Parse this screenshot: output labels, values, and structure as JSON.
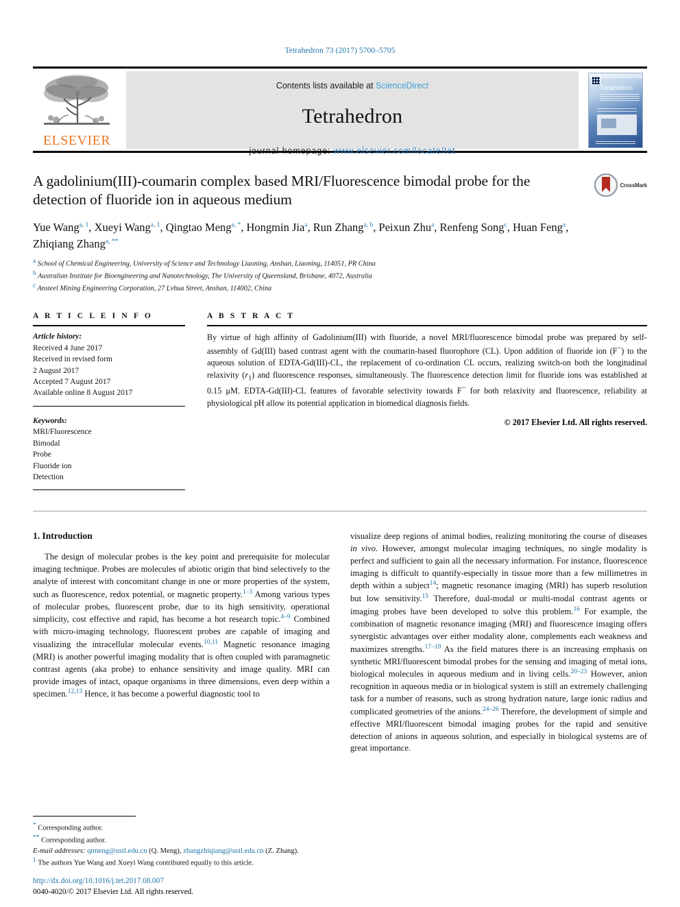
{
  "running_head": "Tetrahedron 73 (2017) 5700–5705",
  "masthead": {
    "publisher_name": "ELSEVIER",
    "contents_prefix": "Contents lists available at ",
    "contents_link": "ScienceDirect",
    "journal_name": "Tetrahedron",
    "homepage_prefix": "journal homepage: ",
    "homepage_url": "www.elsevier.com/locate/tet",
    "cover_title": "Tetrahedron"
  },
  "article": {
    "title": "A gadolinium(III)-coumarin complex based MRI/Fluorescence bimodal probe for the detection of fluoride ion in aqueous medium",
    "crossmark_label": "CrossMark",
    "authors_line1": "Yue Wang",
    "authors_html_line1_sup": "a, 1",
    "affiliations": [
      "School of Chemical Engineering, University of Science and Technology Liaoning, Anshan, Liaoning, 114051, PR China",
      "Australian Institute for Bioengineering and Nanotechnology, The University of Queensland, Brisbane, 4072, Australia",
      "Ansteel Mining Engineering Corporation, 27 Lvhua Street, Anshan, 114002, China"
    ],
    "affiliation_markers": [
      "a",
      "b",
      "c"
    ],
    "authors": [
      {
        "name": "Yue Wang",
        "sup": "a, 1",
        "sep": ", "
      },
      {
        "name": "Xueyi Wang",
        "sup": "a, 1",
        "sep": ", "
      },
      {
        "name": "Qingtao Meng",
        "sup": "a, *",
        "sep": ", "
      },
      {
        "name": "Hongmin Jia",
        "sup": "a",
        "sep": ", "
      },
      {
        "name": "Run Zhang",
        "sup": "a, b",
        "sep": ", "
      },
      {
        "name": "Peixun Zhu",
        "sup": "a",
        "sep": ", "
      },
      {
        "name": "Renfeng Song",
        "sup": "c",
        "sep": ", "
      },
      {
        "name": "Huan Feng",
        "sup": "a",
        "sep": ", "
      },
      {
        "name": "Zhiqiang Zhang",
        "sup": "a, **",
        "sep": ""
      }
    ]
  },
  "article_info": {
    "heading": "A R T I C L E   I N F O",
    "history_label": "Article history:",
    "history": [
      "Received 4 June 2017",
      "Received in revised form",
      "2 August 2017",
      "Accepted 7 August 2017",
      "Available online 8 August 2017"
    ],
    "keywords_label": "Keywords:",
    "keywords": [
      "MRI/Fluorescence",
      "Bimodal",
      "Probe",
      "Fluoride ion",
      "Detection"
    ]
  },
  "abstract": {
    "heading": "A B S T R A C T",
    "text_part1": "By virtue of high affinity of Gadolinium(III) with fluoride, a novel MRI/fluorescence bimodal probe was prepared by self-assembly of Gd(III) based contrast agent with the coumarin-based fluorophore (CL). Upon addition of fluoride ion (F",
    "text_sup1": "−",
    "text_part2": ") to the aqueous solution of EDTA-Gd(III)-CL, the replacement of co-ordination CL occurs, realizing switch-on both the longitudinal relaxivity (",
    "text_italic_r": "r",
    "text_sub_1": "1",
    "text_part3": ") and fluorescence responses, simultaneously. The fluorescence detection limit for fluoride ions was established at 0.15 μM. EDTA-Gd(III)-CL features of favorable selectivity towards F",
    "text_sup2": "−",
    "text_part4": " for both relaxivity and fluorescence, reliability at physiological pH allow its potential application in biomedical diagnosis fields.",
    "copyright": "© 2017 Elsevier Ltd. All rights reserved."
  },
  "introduction": {
    "heading": "1. Introduction",
    "left_paragraph_a": "The design of molecular probes is the key point and prerequisite for molecular imaging technique. Probes are molecules of abiotic origin that bind selectively to the analyte of interest with concomitant change in one or more properties of the system, such as fluorescence, redox potential, or magnetic property.",
    "ref_1_3": "1–3",
    "left_paragraph_b": " Among various types of molecular probes, fluorescent probe, due to its high sensitivity, operational simplicity, cost effective and rapid, has become a hot research topic.",
    "ref_4_9": "4–9",
    "left_paragraph_c": " Combined with micro-imaging technology, fluorescent probes are capable of imaging and visualizing the intracellular molecular events.",
    "ref_10_11": "10,11",
    "left_paragraph_d": " Magnetic resonance imaging (MRI) is another powerful imaging modality that is often coupled with paramagnetic contrast agents (aka probe) to enhance sensitivity and image quality. MRI can provide images of intact, opaque organisms in three dimensions, even deep within a specimen.",
    "ref_12_13": "12,13",
    "left_paragraph_e": " Hence, it has become a powerful diagnostic tool to",
    "right_paragraph_a": "visualize deep regions of animal bodies, realizing monitoring the course of diseases ",
    "right_italic_invivo": "in vivo",
    "right_paragraph_b": ". However, amongst molecular imaging techniques, no single modality is perfect and sufficient to gain all the necessary information. For instance, fluorescence imaging is difficult to quantify-especially in tissue more than a few millimetres in depth within a subject",
    "ref_14": "14",
    "right_paragraph_c": "; magnetic resonance imaging (MRI) has superb resolution but low sensitivity.",
    "ref_15": "15",
    "right_paragraph_d": " Therefore, dual-modal or multi-modal contrast agents or imaging probes have been developed to solve this problem.",
    "ref_16": "16",
    "right_paragraph_e": " For example, the combination of magnetic resonance imaging (MRI) and fluorescence imaging offers synergistic advantages over either modality alone, complements each weakness and maximizes strengths.",
    "ref_17_19": "17–19",
    "right_paragraph_f": " As the field matures there is an increasing emphasis on synthetic MRI/fluorescent bimodal probes for the sensing and imaging of metal ions, biological molecules in aqueous medium and in living cells.",
    "ref_20_23": "20–23",
    "right_paragraph_g": " However, anion recognition in aqueous media or in biological system is still an extremely challenging task for a number of reasons, such as strong hydration nature, large ionic radius and complicated geometries of the anions.",
    "ref_24_26": "24–26",
    "right_paragraph_h": " Therefore, the development of simple and effective MRI/fluorescent bimodal imaging probes for the rapid and sensitive detection of anions in aqueous solution, and especially in biological systems are of great importance."
  },
  "footnotes": {
    "corr1_marker": "*",
    "corr1_text": "Corresponding author.",
    "corr2_marker": "**",
    "corr2_text": "Corresponding author.",
    "email_label": "E-mail addresses:",
    "email1": "qtmeng@ustl.edu.cn",
    "email1_owner": "(Q. Meng)",
    "email2": "zhangzhiqiang@ustl.edu.cn",
    "email2_owner": "(Z. Zhang).",
    "equal_marker": "1",
    "equal_text": "The authors Yue Wang and Xueyi Wang contributed equally to this article."
  },
  "imprint": {
    "doi": "http://dx.doi.org/10.1016/j.tet.2017.08.007",
    "issn_line": "0040-4020/© 2017 Elsevier Ltd. All rights reserved."
  },
  "colors": {
    "link_blue": "#1b74a8",
    "elsevier_orange": "#e87722",
    "masthead_gray": "#e3e3e3"
  }
}
